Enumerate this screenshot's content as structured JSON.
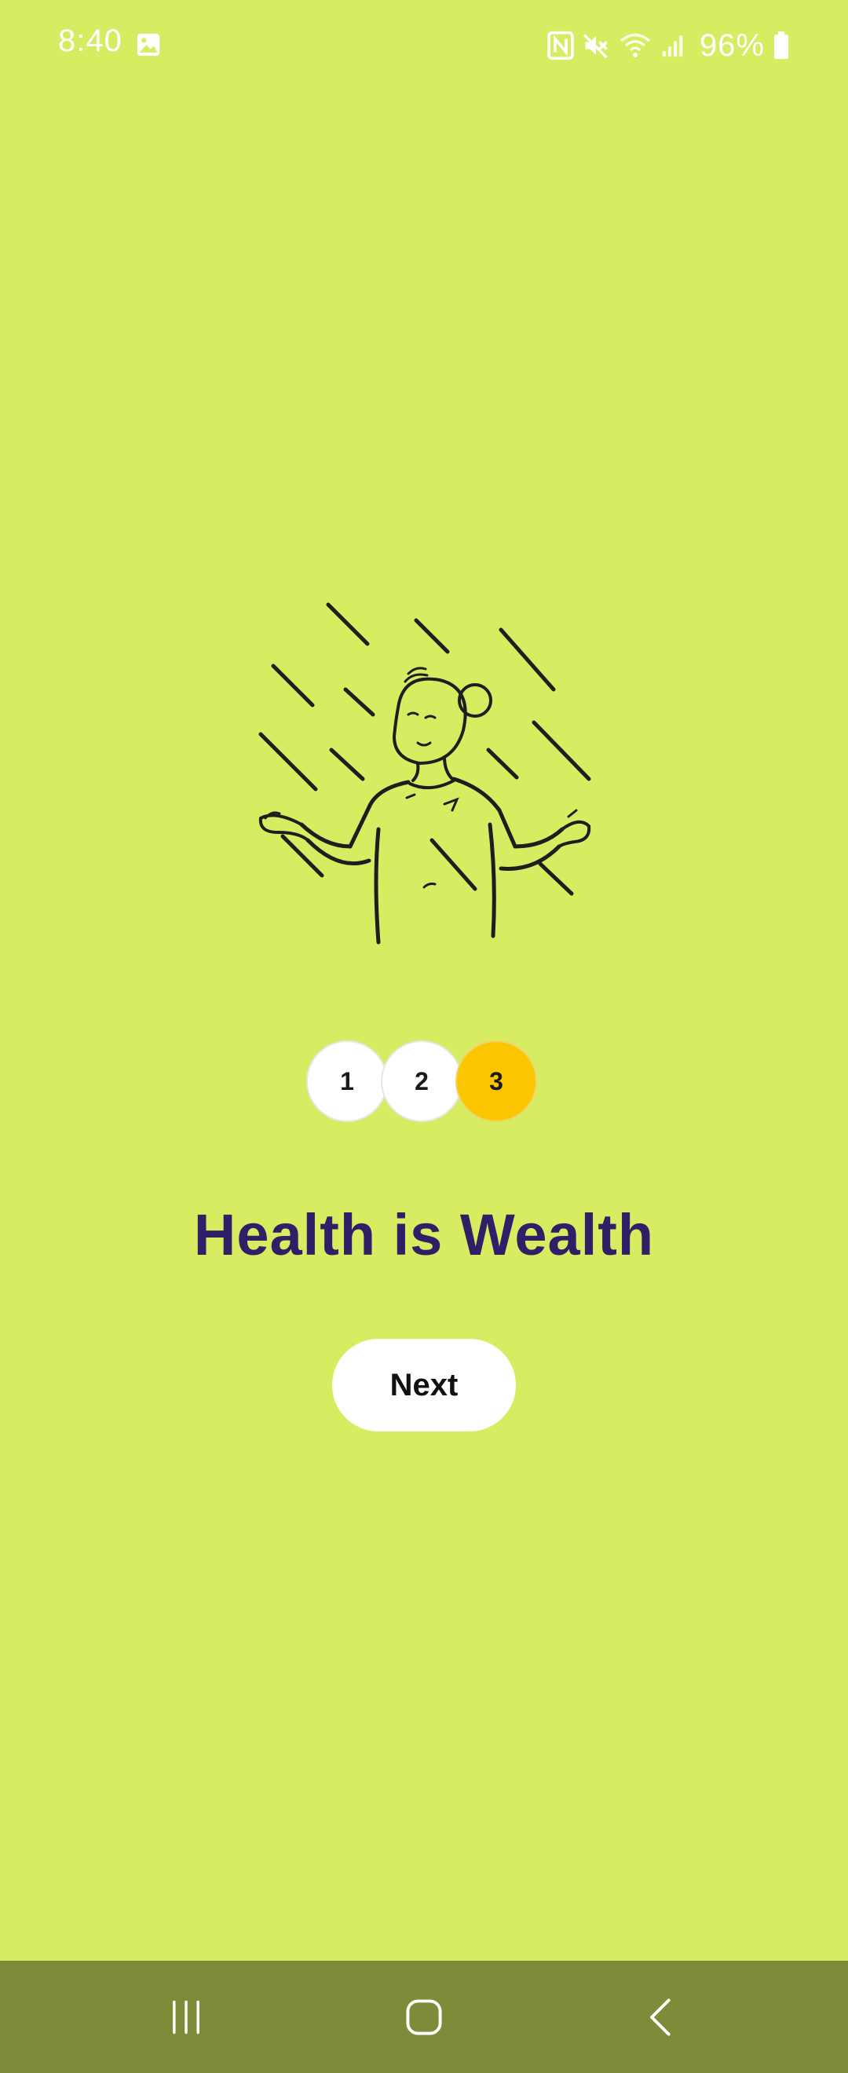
{
  "status_bar": {
    "time": "8:40",
    "battery_percent": "96%",
    "icons": [
      "gallery-icon",
      "nfc-icon",
      "mute-icon",
      "wifi-icon",
      "signal-icon",
      "battery-icon"
    ]
  },
  "onboarding": {
    "steps": [
      {
        "label": "1",
        "active": false
      },
      {
        "label": "2",
        "active": false
      },
      {
        "label": "3",
        "active": true
      }
    ],
    "title": "Health is Wealth",
    "next_label": "Next"
  },
  "colors": {
    "background": "#d8ec62",
    "title": "#2e1f66",
    "active_step": "#fbc600",
    "nav_bar": "#7f8b38"
  },
  "nav_bar": {
    "icons": [
      "recents-icon",
      "home-icon",
      "back-icon"
    ]
  }
}
